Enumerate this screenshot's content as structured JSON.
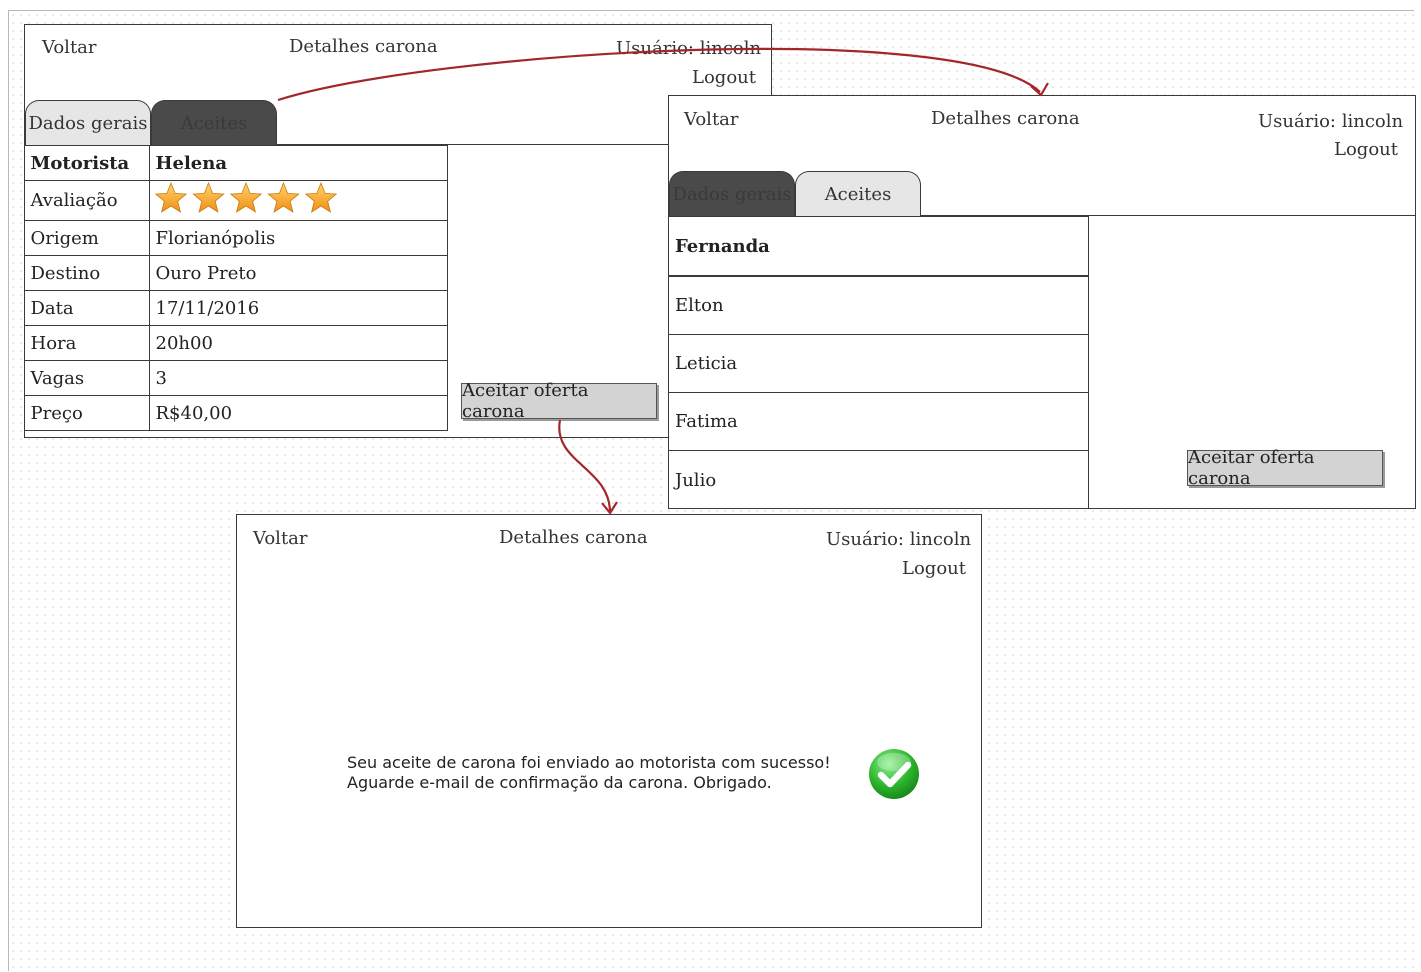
{
  "screen_details": {
    "back": "Voltar",
    "title": "Detalhes carona",
    "user": "Usuário: lincoln",
    "logout": "Logout",
    "tabs": [
      "Dados gerais",
      "Aceites"
    ],
    "rows": [
      {
        "label": "Motorista",
        "value": "Helena"
      },
      {
        "label": "Avaliação",
        "value": "",
        "stars": 5
      },
      {
        "label": "Origem",
        "value": "Florianópolis"
      },
      {
        "label": "Destino",
        "value": "Ouro Preto"
      },
      {
        "label": "Data",
        "value": "17/11/2016"
      },
      {
        "label": "Hora",
        "value": "20h00"
      },
      {
        "label": "Vagas",
        "value": "3"
      },
      {
        "label": "Preço",
        "value": "R$40,00"
      }
    ],
    "accept_button": "Aceitar oferta carona"
  },
  "screen_accepts": {
    "back": "Voltar",
    "title": "Detalhes carona",
    "user": "Usuário: lincoln",
    "logout": "Logout",
    "tabs": [
      "Dados gerais",
      "Aceites"
    ],
    "list": [
      "Fernanda",
      "Elton",
      "Leticia",
      "Fatima",
      "Julio"
    ],
    "accept_button": "Aceitar oferta carona"
  },
  "screen_success": {
    "back": "Voltar",
    "title": "Detalhes carona",
    "user": "Usuário: lincoln",
    "logout": "Logout",
    "message_line1": "Seu aceite de carona foi enviado ao motorista com sucesso!",
    "message_line2": "Aguarde e-mail de confirmação da carona. Obrigado."
  },
  "colors": {
    "arrow": "#a3262a",
    "success_icon": "#2db52d",
    "star": "#f5a623"
  }
}
